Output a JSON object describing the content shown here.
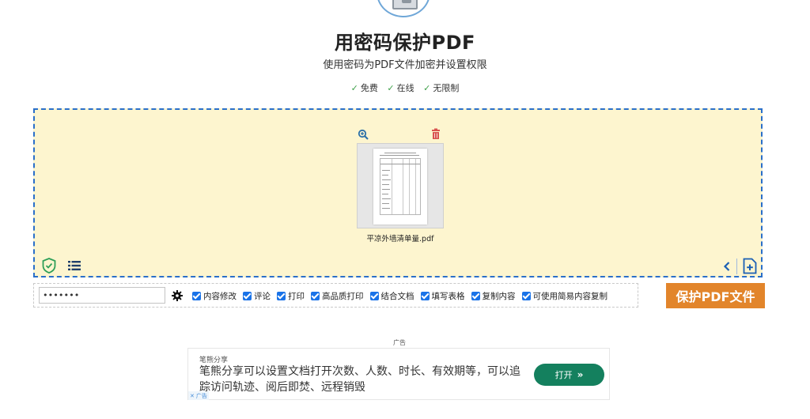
{
  "header": {
    "title": "用密码保护PDF",
    "subtitle": "使用密码为PDF文件加密并设置权限",
    "features": [
      "免费",
      "在线",
      "无限制"
    ],
    "check_glyph": "✓"
  },
  "dropzone": {
    "file_name": "平凉外墙清单量.pdf",
    "icons": [
      "zoom-in-icon",
      "trash-icon",
      "shield-check-icon",
      "list-icon",
      "chevron-left-icon",
      "add-file-icon"
    ]
  },
  "settings": {
    "password_value": "•••••••",
    "permissions": [
      {
        "label": "内容修改",
        "checked": true
      },
      {
        "label": "评论",
        "checked": true
      },
      {
        "label": "打印",
        "checked": true
      },
      {
        "label": "高品质打印",
        "checked": true
      },
      {
        "label": "结合文档",
        "checked": true
      },
      {
        "label": "填写表格",
        "checked": true
      },
      {
        "label": "复制内容",
        "checked": true
      },
      {
        "label": "可使用简易内容复制",
        "checked": true
      }
    ]
  },
  "protect_button": {
    "label": "保护PDF文件"
  },
  "ad": {
    "label": "广告",
    "source": "笔熊分享",
    "text": "笔熊分享可以设置文档打开次数、人数、时长、有效期等，可以追踪访问轨迹、阅后即焚、远程销毁",
    "open_label": "打开",
    "open_arrows": "»",
    "choice_label": "广告"
  },
  "colors": {
    "accent_blue": "#2a6fc9",
    "dropzone_bg": "#fdf5cf",
    "button_orange": "#e2852b",
    "ad_green": "#14805e",
    "check_green": "#3fa14a",
    "trash_red": "#d9534f"
  }
}
